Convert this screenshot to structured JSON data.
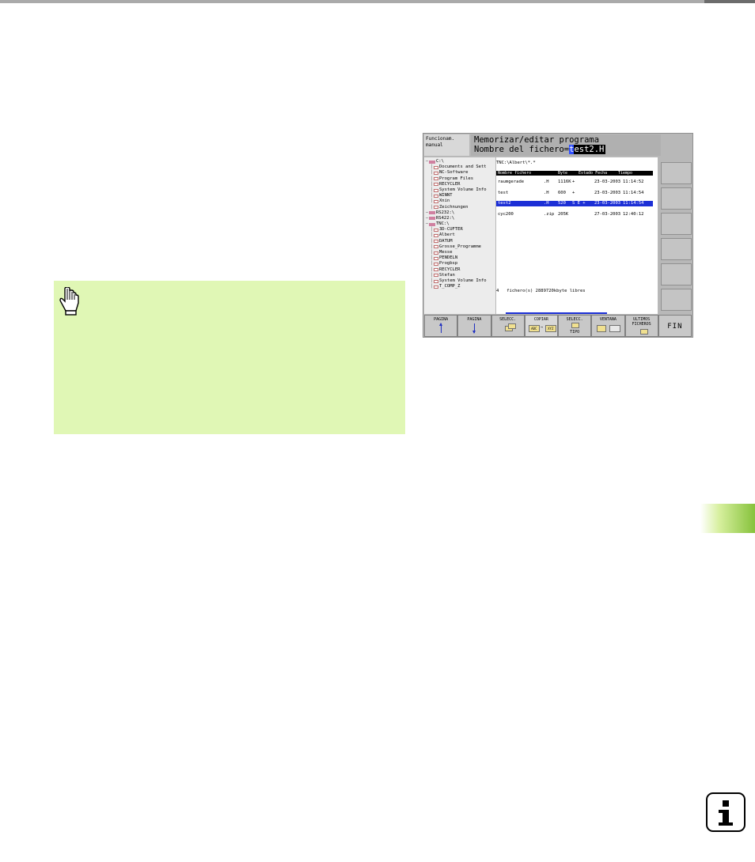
{
  "tnc": {
    "mode_label": "Funcionam.\nmanual",
    "header_line1": "Memorizar/editar programa",
    "header_line2_prefix": "Nombre del fichero=",
    "header_line2_cursor": "t",
    "header_line2_value": "est2.H",
    "tree": [
      {
        "label": "C:\\",
        "type": "drive",
        "indent": 0
      },
      {
        "label": "Documents and Sett",
        "type": "folder",
        "indent": 1
      },
      {
        "label": "NC-Software",
        "type": "folder",
        "indent": 1
      },
      {
        "label": "Program Files",
        "type": "folder",
        "indent": 1
      },
      {
        "label": "RECYCLER",
        "type": "folder",
        "indent": 1
      },
      {
        "label": "System Volume Info",
        "type": "folder",
        "indent": 1
      },
      {
        "label": "WINNT",
        "type": "folder",
        "indent": 1
      },
      {
        "label": "Xnin",
        "type": "folder",
        "indent": 1
      },
      {
        "label": "Zeichnungen",
        "type": "folder",
        "indent": 1
      },
      {
        "label": "RS232:\\",
        "type": "drive",
        "indent": 0
      },
      {
        "label": "RS422:\\",
        "type": "drive",
        "indent": 0
      },
      {
        "label": "TNC:\\",
        "type": "drive",
        "indent": 0
      },
      {
        "label": "3D-CUFTER",
        "type": "folder",
        "indent": 1
      },
      {
        "label": "Albert",
        "type": "folder",
        "indent": 1
      },
      {
        "label": "DATUM",
        "type": "folder",
        "indent": 1
      },
      {
        "label": "Grosse_Programme",
        "type": "folder",
        "indent": 1
      },
      {
        "label": "Messe",
        "type": "folder",
        "indent": 1
      },
      {
        "label": "PENDELN",
        "type": "folder",
        "indent": 1
      },
      {
        "label": "Progbsp",
        "type": "folder",
        "indent": 1
      },
      {
        "label": "RECYCLER",
        "type": "folder",
        "indent": 1
      },
      {
        "label": "Stefan",
        "type": "folder",
        "indent": 1
      },
      {
        "label": "System Volume Info",
        "type": "folder",
        "indent": 1
      },
      {
        "label": "T_COMP_Z",
        "type": "folder",
        "indent": 1
      }
    ],
    "path": "TNC:\\Albert\\*.*",
    "columns": [
      "Nombre fichero",
      "Byte",
      "Estado",
      "Fecha",
      "Tiempo"
    ],
    "files": [
      {
        "name": "raumgerade",
        "ext": ".H",
        "size": "1116K",
        "status": "+",
        "date": "23-03-2003",
        "time": "11:14:52",
        "selected": false
      },
      {
        "name": "test",
        "ext": ".H",
        "size": "600",
        "status": "+",
        "date": "23-03-2003",
        "time": "11:14:54",
        "selected": false
      },
      {
        "name": "test2",
        "ext": ".H",
        "size": "520",
        "status": "S E +",
        "date": "23-03-2003",
        "time": "11:14:54",
        "selected": true
      },
      {
        "name": "cyc200",
        "ext": ".zip",
        "size": "205K",
        "status": "",
        "date": "27-03-2003",
        "time": "12:40:12",
        "selected": false
      }
    ],
    "status_count": "4",
    "status_text": "fichero(s) 2889720kbyte libres",
    "softkeys": [
      {
        "label": "PAGINA",
        "icon": "arrow-up-icon"
      },
      {
        "label": "PAGINA",
        "icon": "arrow-down-icon"
      },
      {
        "label": "SELECC.",
        "icon": "copy-files-icon"
      },
      {
        "label": "COPIAR",
        "icon": "abc-to-xyz-icon",
        "from": "ABC",
        "to": "XYZ"
      },
      {
        "label": "SELECC.",
        "label2": "TIPO",
        "icon": "file-type-icon"
      },
      {
        "label": "VENTANA",
        "icon": "window-split-icon"
      },
      {
        "label": "ULTIMOS",
        "label2": "FICHEROS",
        "icon": "recent-files-icon"
      },
      {
        "label": "FIN",
        "icon": ""
      }
    ]
  },
  "colors": {
    "note_background": "#e0f7b5",
    "selection_blue": "#1c2fd6",
    "tab_green": "#86c23b"
  }
}
